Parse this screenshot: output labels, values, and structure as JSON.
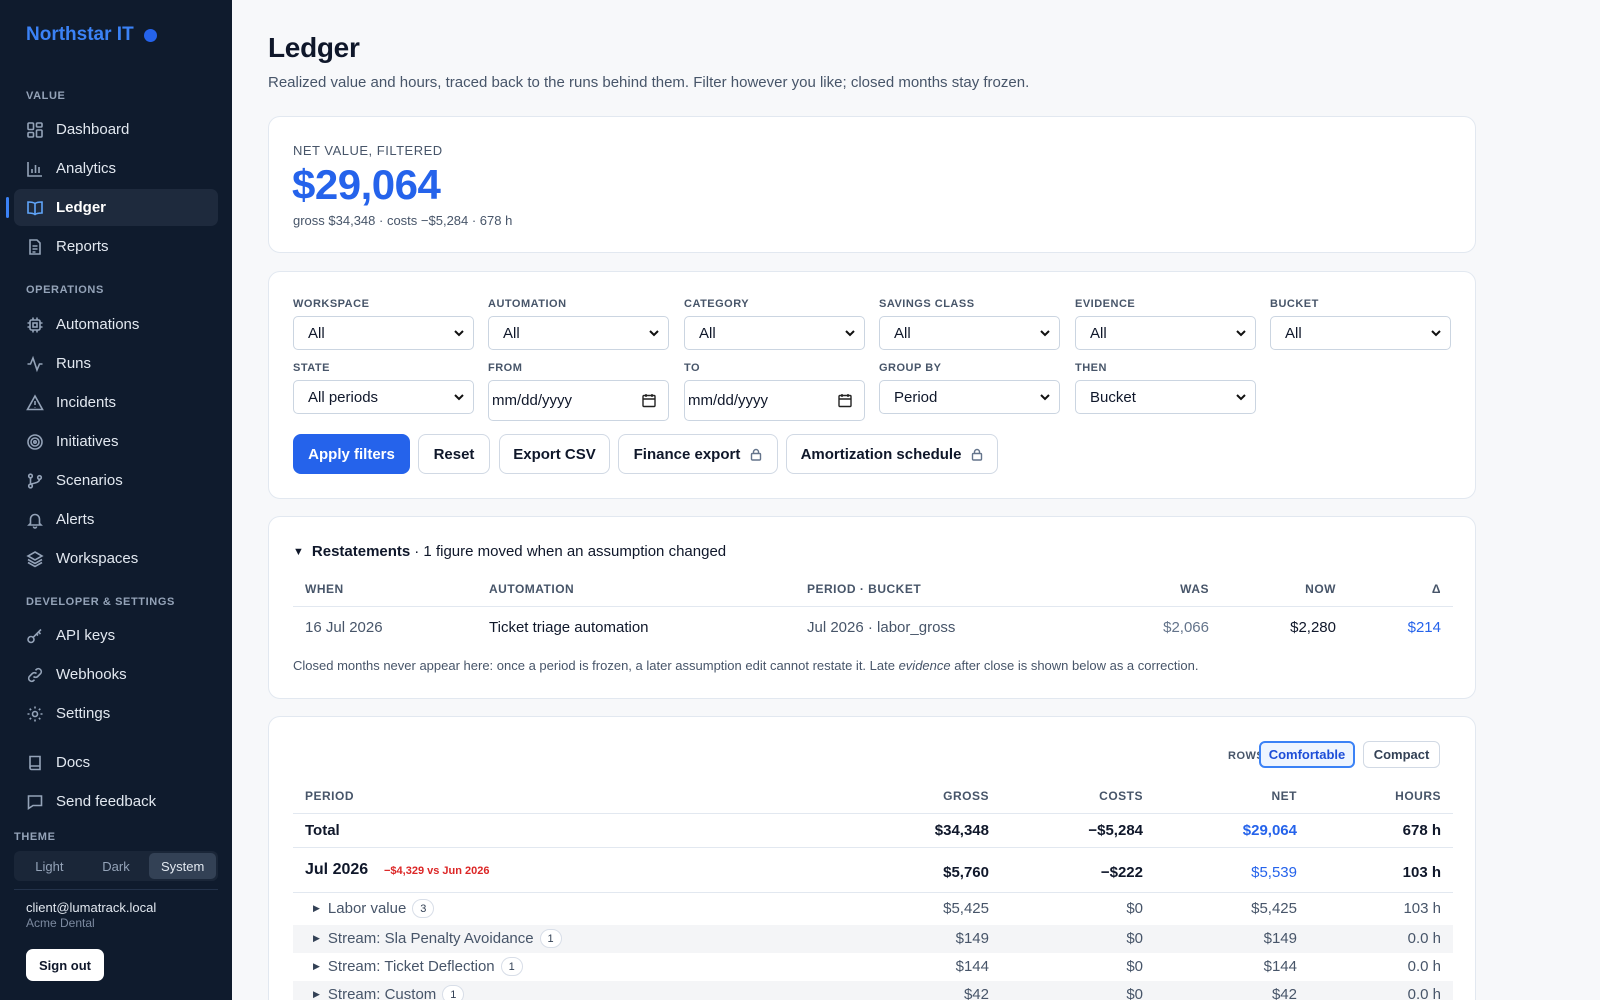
{
  "app": {
    "brand": "Northstar IT"
  },
  "sidebar": {
    "sections": [
      {
        "label": "VALUE"
      },
      {
        "label": "OPERATIONS"
      },
      {
        "label": "DEVELOPER & SETTINGS"
      }
    ],
    "items": [
      {
        "label": "Dashboard",
        "icon": "grid-icon"
      },
      {
        "label": "Analytics",
        "icon": "bar-chart-icon"
      },
      {
        "label": "Ledger",
        "icon": "book-icon",
        "active": true
      },
      {
        "label": "Reports",
        "icon": "document-icon"
      },
      {
        "label": "Automations",
        "icon": "cpu-icon"
      },
      {
        "label": "Runs",
        "icon": "activity-icon"
      },
      {
        "label": "Incidents",
        "icon": "alert-triangle-icon"
      },
      {
        "label": "Initiatives",
        "icon": "target-icon"
      },
      {
        "label": "Scenarios",
        "icon": "git-branch-icon"
      },
      {
        "label": "Alerts",
        "icon": "bell-icon"
      },
      {
        "label": "Workspaces",
        "icon": "layers-icon"
      },
      {
        "label": "API keys",
        "icon": "key-icon"
      },
      {
        "label": "Webhooks",
        "icon": "link-icon"
      },
      {
        "label": "Settings",
        "icon": "gear-icon"
      },
      {
        "label": "Docs",
        "icon": "book-closed-icon"
      },
      {
        "label": "Send feedback",
        "icon": "message-icon"
      }
    ],
    "theme": {
      "label": "THEME",
      "options": [
        "Light",
        "Dark",
        "System"
      ],
      "selected": "System"
    },
    "user": {
      "email": "client@lumatrack.local",
      "org": "Acme Dental"
    },
    "signout": "Sign out"
  },
  "page": {
    "title": "Ledger",
    "subtitle": "Realized value and hours, traced back to the runs behind them. Filter however you like; closed months stay frozen."
  },
  "kpi": {
    "label": "NET VALUE, FILTERED",
    "value": "$29,064",
    "sub": "gross $34,348 · costs −$5,284 · 678 h"
  },
  "filters": {
    "workspace": {
      "label": "WORKSPACE",
      "value": "All"
    },
    "automation": {
      "label": "AUTOMATION",
      "value": "All"
    },
    "category": {
      "label": "CATEGORY",
      "value": "All"
    },
    "savings_class": {
      "label": "SAVINGS CLASS",
      "value": "All"
    },
    "evidence": {
      "label": "EVIDENCE",
      "value": "All"
    },
    "bucket": {
      "label": "BUCKET",
      "value": "All"
    },
    "state": {
      "label": "STATE",
      "value": "All periods"
    },
    "from": {
      "label": "FROM",
      "placeholder": "mm/dd/yyyy"
    },
    "to": {
      "label": "TO",
      "placeholder": "mm/dd/yyyy"
    },
    "group_by": {
      "label": "GROUP BY",
      "value": "Period"
    },
    "then": {
      "label": "THEN",
      "value": "Bucket"
    },
    "buttons": {
      "apply": "Apply filters",
      "reset": "Reset",
      "export_csv": "Export CSV",
      "finance_export": "Finance export",
      "amortization": "Amortization schedule"
    }
  },
  "restatements": {
    "title": "Restatements",
    "summary": " · 1 figure moved when an assumption changed",
    "columns": [
      "WHEN",
      "AUTOMATION",
      "PERIOD · BUCKET",
      "WAS",
      "NOW",
      "Δ"
    ],
    "rows": [
      {
        "when": "16 Jul 2026",
        "automation": "Ticket triage automation",
        "period_bucket": "Jul 2026 · labor_gross",
        "was": "$2,066",
        "now": "$2,280",
        "delta": "$214"
      }
    ],
    "note_pre": "Closed months never appear here: once a period is frozen, a later assumption edit cannot restate it. Late ",
    "note_em": "evidence",
    "note_post": " after close is shown below as a correction."
  },
  "ledger": {
    "rows_label": "ROWS",
    "density": {
      "comfortable": "Comfortable",
      "compact": "Compact",
      "selected": "Comfortable"
    },
    "columns": [
      "PERIOD",
      "GROSS",
      "COSTS",
      "NET",
      "HOURS"
    ],
    "total": {
      "label": "Total",
      "gross": "$34,348",
      "costs": "−$5,284",
      "net": "$29,064",
      "hours": "678 h"
    },
    "period": {
      "label": "Jul 2026",
      "change": "−$4,329 vs Jun 2026",
      "gross": "$5,760",
      "costs": "−$222",
      "net": "$5,539",
      "hours": "103 h"
    },
    "children": [
      {
        "label": "Labor value",
        "count": "3",
        "gross": "$5,425",
        "costs": "$0",
        "net": "$5,425",
        "hours": "103 h"
      },
      {
        "label": "Stream: Sla Penalty Avoidance",
        "count": "1",
        "gross": "$149",
        "costs": "$0",
        "net": "$149",
        "hours": "0.0 h"
      },
      {
        "label": "Stream: Ticket Deflection",
        "count": "1",
        "gross": "$144",
        "costs": "$0",
        "net": "$144",
        "hours": "0.0 h"
      },
      {
        "label": "Stream: Custom",
        "count": "1",
        "gross": "$42",
        "costs": "$0",
        "net": "$42",
        "hours": "0.0 h"
      }
    ]
  },
  "colors": {
    "accent": "#2563eb",
    "sidebar_bg": "#0f1b2d",
    "negative": "#dc2626"
  }
}
